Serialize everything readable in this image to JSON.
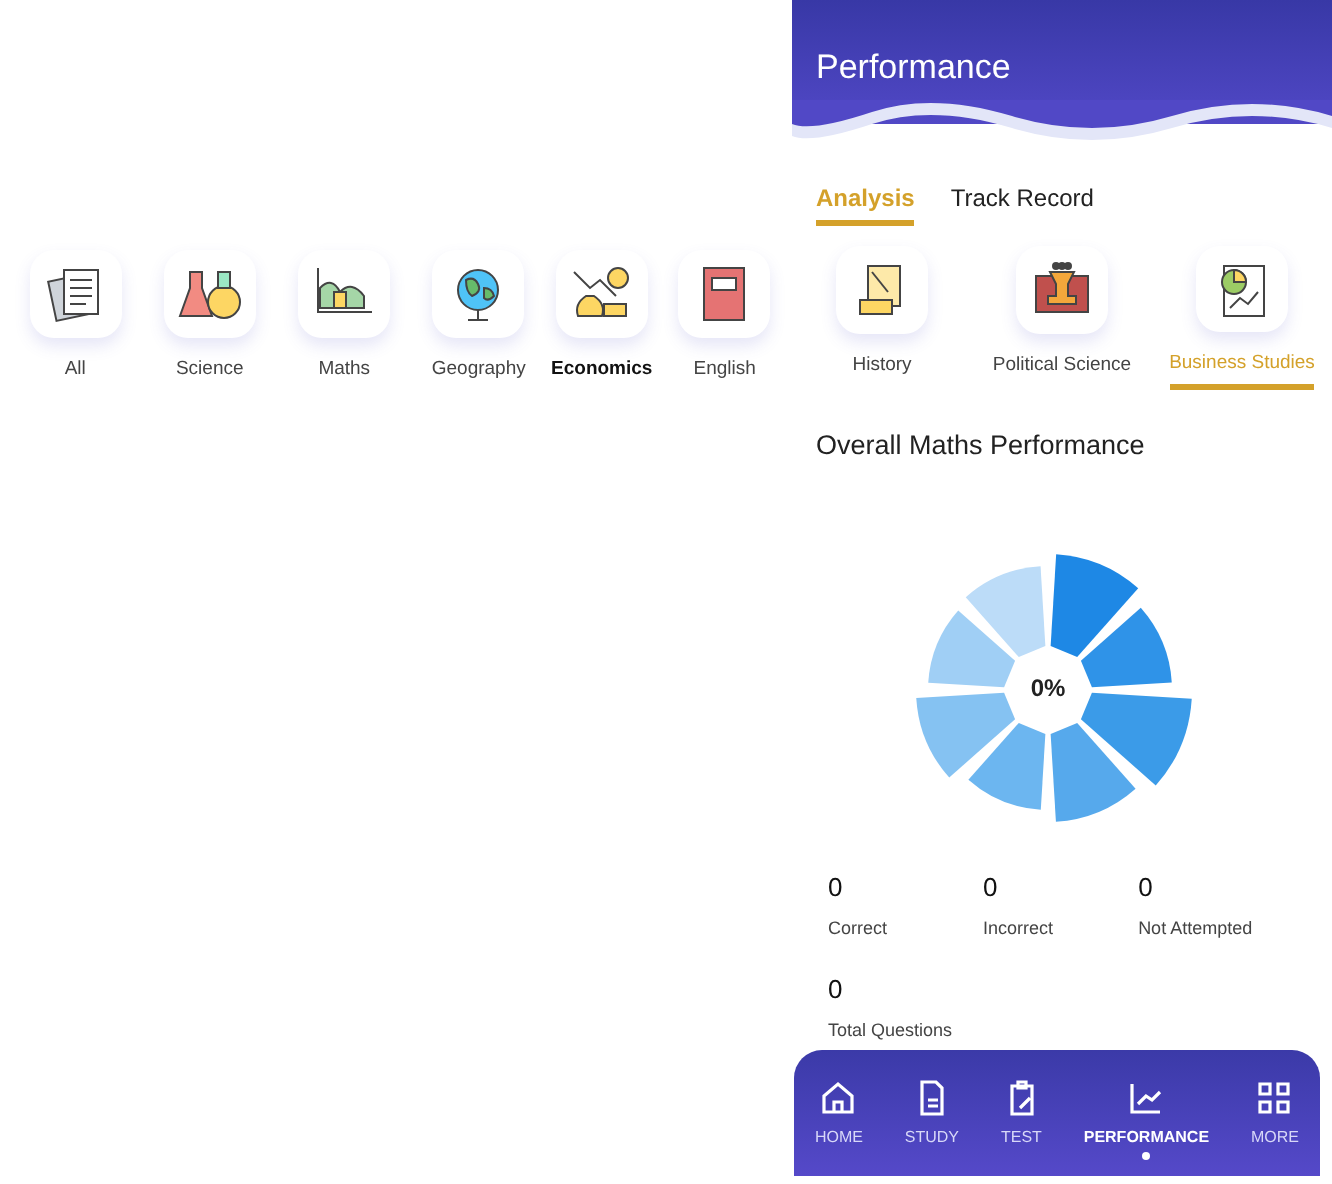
{
  "left_subjects": [
    {
      "label": "All",
      "selected": false
    },
    {
      "label": "Science",
      "selected": false
    },
    {
      "label": "Maths",
      "selected": false
    },
    {
      "label": "Geography",
      "selected": false
    },
    {
      "label": "Economics",
      "selected": true
    },
    {
      "label": "English",
      "selected": false
    }
  ],
  "header": {
    "title": "Performance"
  },
  "tabs": [
    {
      "label": "Analysis",
      "selected": true
    },
    {
      "label": "Track Record",
      "selected": false
    }
  ],
  "subjects": [
    {
      "label": "History",
      "selected": false
    },
    {
      "label": "Political Science",
      "selected": false
    },
    {
      "label": "Business Studies",
      "selected": true
    }
  ],
  "section_title": "Overall Maths Performance",
  "chart": {
    "center_label": "0%"
  },
  "stats": [
    {
      "value": "0",
      "label": "Correct"
    },
    {
      "value": "0",
      "label": "Incorrect"
    },
    {
      "value": "0",
      "label": "Not Attempted"
    }
  ],
  "total": {
    "value": "0",
    "label": "Total Questions"
  },
  "nav": [
    {
      "label": "HOME",
      "selected": false
    },
    {
      "label": "STUDY",
      "selected": false
    },
    {
      "label": "TEST",
      "selected": false
    },
    {
      "label": "PERFORMANCE",
      "selected": true
    },
    {
      "label": "MORE",
      "selected": false
    }
  ]
}
